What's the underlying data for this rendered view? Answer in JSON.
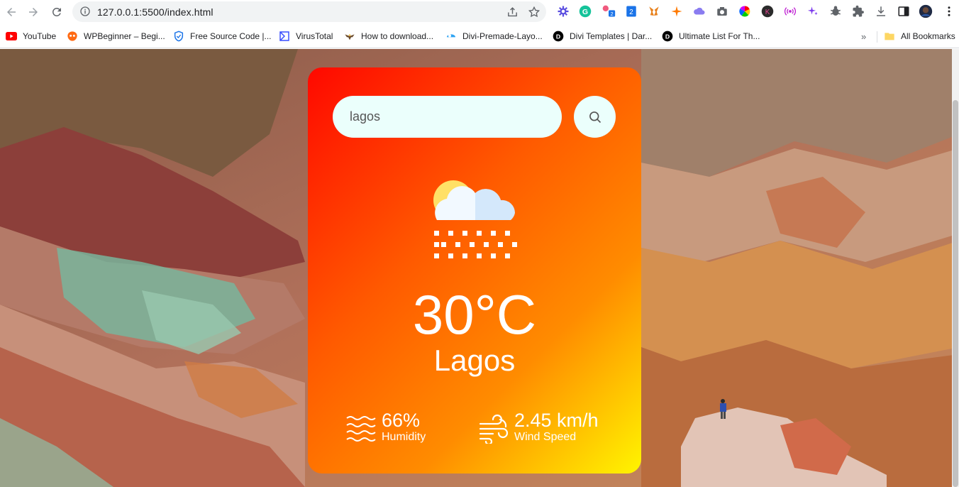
{
  "browser": {
    "url": "127.0.0.1:5500/index.html",
    "extension_badge": "2",
    "extension_badge_2": "2",
    "extension_letter": "K",
    "bookmarks": [
      {
        "label": "YouTube",
        "icon": "youtube-icon",
        "color": "#ff0000"
      },
      {
        "label": "WPBeginner – Begi...",
        "icon": "wpbeginner-icon",
        "color": "#ff6a13"
      },
      {
        "label": "Free Source Code |...",
        "icon": "shield-icon",
        "color": "#1a73e8"
      },
      {
        "label": "VirusTotal",
        "icon": "virustotal-icon",
        "color": "#394eff"
      },
      {
        "label": "How to download...",
        "icon": "eagle-icon",
        "color": "#6b4a2b"
      },
      {
        "label": "Divi-Premade-Layo...",
        "icon": "divi-icon",
        "color": "#2ea3f2"
      },
      {
        "label": "Divi Templates | Dar...",
        "icon": "d-icon",
        "color": "#000000"
      },
      {
        "label": "Ultimate List For Th...",
        "icon": "d-icon",
        "color": "#000000"
      }
    ],
    "bookmarks_overflow": "»",
    "all_bookmarks": "All Bookmarks"
  },
  "weather": {
    "search_value": "lagos",
    "temperature": "30°C",
    "city": "Lagos",
    "humidity_value": "66%",
    "humidity_label": "Humidity",
    "wind_value": "2.45 km/h",
    "wind_label": "Wind Speed",
    "condition_icon": "snow-icon"
  },
  "colors": {
    "card_gradient_start": "#ff0800",
    "card_gradient_end": "#fff500",
    "input_bg": "#ebfffc"
  }
}
